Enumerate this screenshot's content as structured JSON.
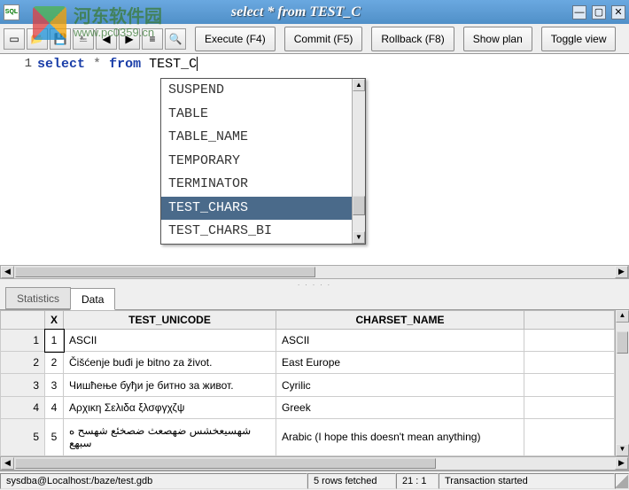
{
  "window": {
    "title": "select * from TEST_C",
    "appicon_label": "SQL"
  },
  "watermark": {
    "cn": "河东软件园",
    "url": "www.pc0359.cn"
  },
  "toolbar": {
    "icons": [
      "new",
      "open",
      "save",
      "save-plus",
      "prev",
      "next",
      "history",
      "zoom"
    ],
    "execute": "Execute (F4)",
    "commit": "Commit (F5)",
    "rollback": "Rollback (F8)",
    "showplan": "Show plan",
    "toggleview": "Toggle view"
  },
  "editor": {
    "line_no": "1",
    "kw_select": "select",
    "star": "*",
    "kw_from": "from",
    "identifier": "TEST_C"
  },
  "autocomplete": {
    "items": [
      "SUSPEND",
      "TABLE",
      "TABLE_NAME",
      "TEMPORARY",
      "TERMINATOR",
      "TEST_CHARS",
      "TEST_CHARS_BI"
    ],
    "selected_index": 5
  },
  "tabs": {
    "statistics": "Statistics",
    "data": "Data",
    "active": "data"
  },
  "grid": {
    "x_header": "X",
    "headers": [
      "TEST_UNICODE",
      "CHARSET_NAME"
    ],
    "rows": [
      {
        "n": "1",
        "x": "1",
        "c0": "ASCII",
        "c1": "ASCII"
      },
      {
        "n": "2",
        "x": "2",
        "c0": "Čišćenje buđi je bitno za život.",
        "c1": "East Europe"
      },
      {
        "n": "3",
        "x": "3",
        "c0": "Чишћење буђи је битно за живот.",
        "c1": "Cyrilic"
      },
      {
        "n": "4",
        "x": "4",
        "c0": "Αρχικη Σελιδα ξλσφγχζψ",
        "c1": "Greek"
      },
      {
        "n": "5",
        "x": "5",
        "c0": "شهسيعخشس ضهصعث ضصخئع شهسح ه سبهع",
        "c1": "Arabic (I hope this doesn't mean anything)"
      }
    ]
  },
  "status": {
    "connection": "sysdba@Localhost:/baze/test.gdb",
    "rows": "5 rows fetched",
    "cursor": "21 : 1",
    "transaction": "Transaction started"
  }
}
